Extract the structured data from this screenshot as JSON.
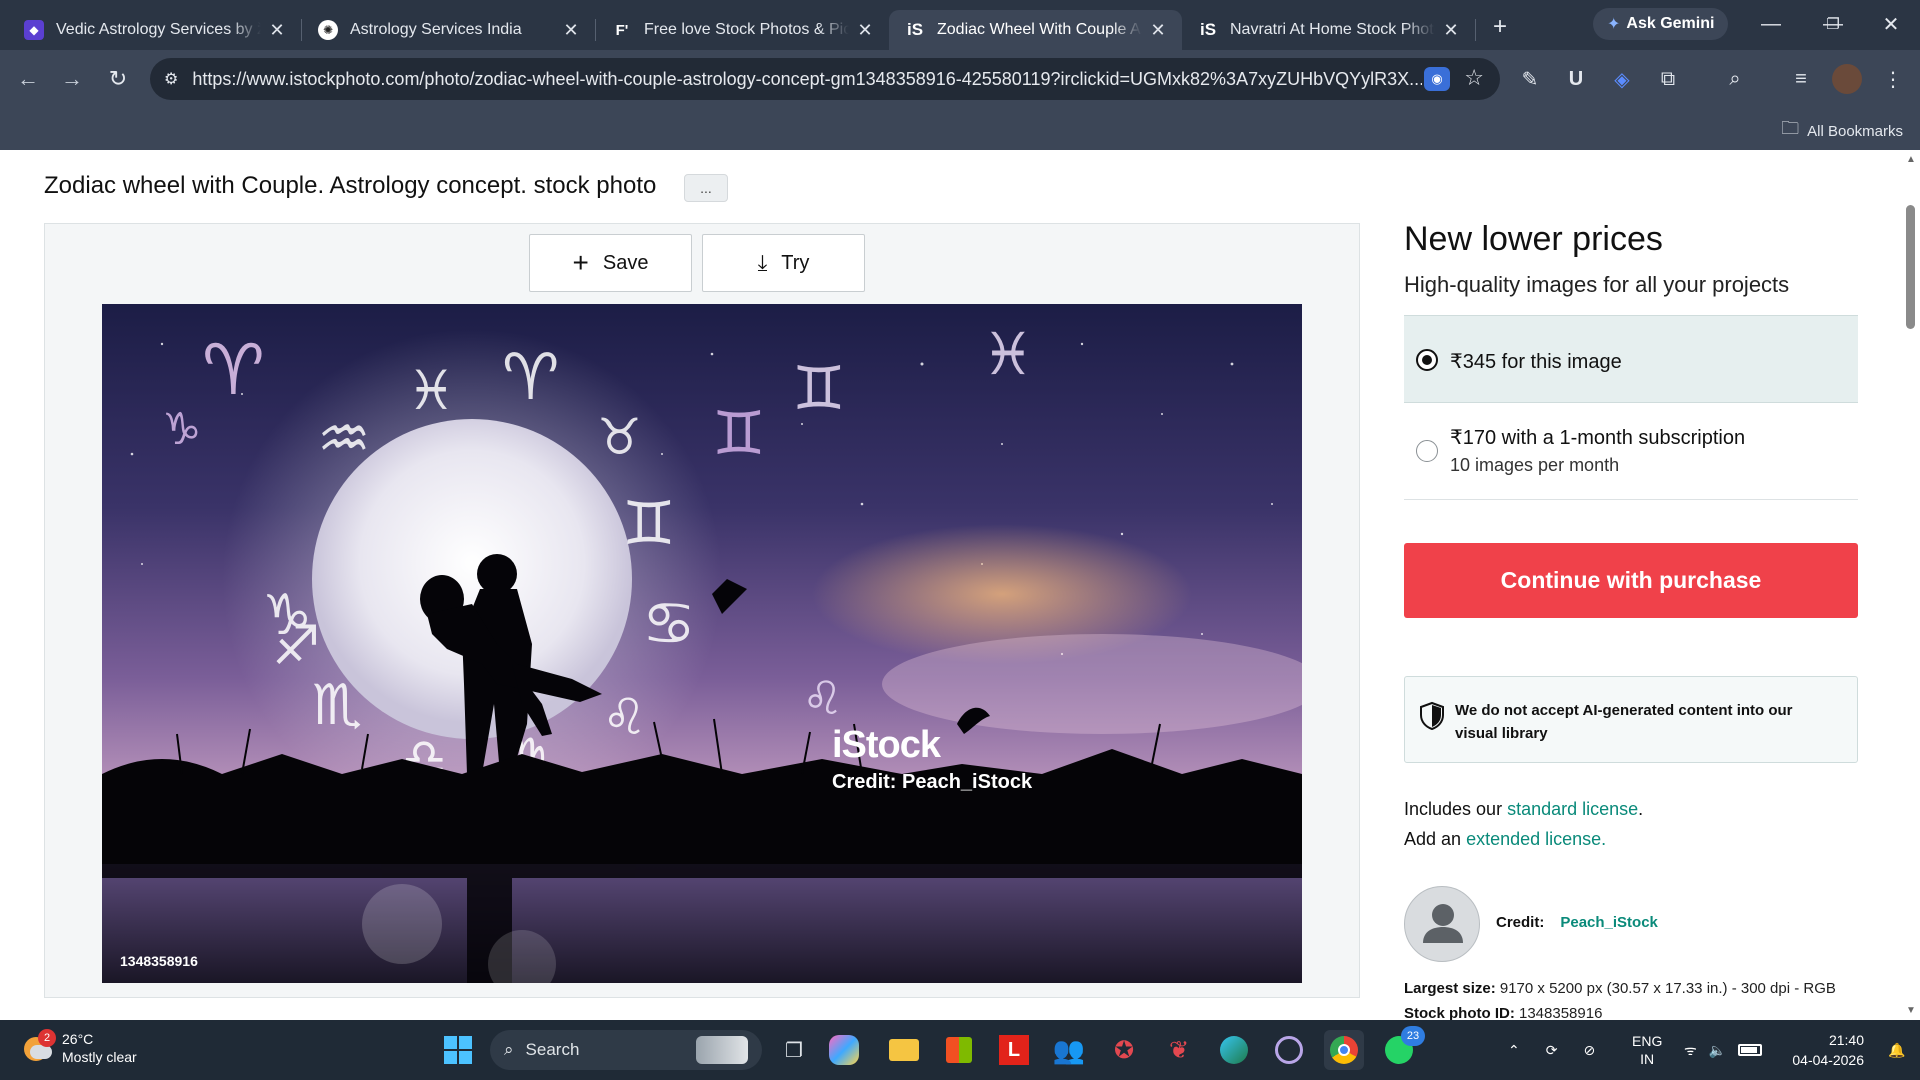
{
  "browser": {
    "tabs": [
      {
        "title": "Vedic Astrology Services by žva",
        "favicon": "vedic-logo-icon",
        "active": false
      },
      {
        "title": "Astrology Services India",
        "favicon": "openai-logo-icon",
        "active": false
      },
      {
        "title": "Free love Stock Photos & Pictu",
        "favicon": "freepik-logo-icon",
        "active": false
      },
      {
        "title": "Zodiac Wheel With Couple Ast",
        "favicon": "istock-logo-icon",
        "active": true
      },
      {
        "title": "Navratri At Home Stock Photo",
        "favicon": "istock-logo-icon",
        "active": false
      }
    ],
    "gemini_label": "Ask Gemini",
    "url": "https://www.istockphoto.com/photo/zodiac-wheel-with-couple-astrology-concept-gm1348358916-425580119?irclickid=UGMxk82%3A7xyZUHbVQYylR3X...",
    "bookmarks_label": "All Bookmarks"
  },
  "page": {
    "title": "Zodiac wheel with Couple. Astrology concept. stock photo",
    "more_label": "...",
    "save_label": "Save",
    "try_label": "Try",
    "watermark_brand": "iStock",
    "watermark_credit": "Credit: Peach_iStock",
    "photo_id_overlay": "1348358916"
  },
  "pricing": {
    "heading": "New lower prices",
    "subheading": "High-quality images for all your projects",
    "options": [
      {
        "label": "₹345 for this image",
        "sub": "",
        "selected": true
      },
      {
        "label": "₹170 with a 1-month subscription",
        "sub": "10 images per month",
        "selected": false
      }
    ],
    "cta_label": "Continue with purchase",
    "ai_note": "We do not accept AI-generated content into our visual library",
    "license_line1_prefix": "Includes our ",
    "license_line1_link": "standard license",
    "license_line1_suffix": ".",
    "license_line2_prefix": "Add an ",
    "license_line2_link": "extended license.",
    "credit_label": "Credit:",
    "credit_value": "Peach_iStock",
    "largest_size_label": "Largest size:",
    "largest_size_value": "9170 x 5200 px (30.57 x 17.33 in.) - 300 dpi - RGB",
    "stock_id_label": "Stock photo ID:",
    "stock_id_value": "1348358916"
  },
  "taskbar": {
    "weather_temp": "26°C",
    "weather_desc": "Mostly clear",
    "weather_badge": "2",
    "search_label": "Search",
    "whatsapp_badge": "23",
    "lang_line1": "ENG",
    "lang_line2": "IN",
    "time": "21:40",
    "date": "04-04-2026"
  },
  "colors": {
    "chrome_dark": "#2b3544",
    "chrome_toolbar": "#3c4657",
    "cta_red": "#f0414a",
    "link_teal": "#0a8a7a",
    "selected_option_bg": "#e6efef",
    "taskbar_bg": "#1f2a36"
  }
}
